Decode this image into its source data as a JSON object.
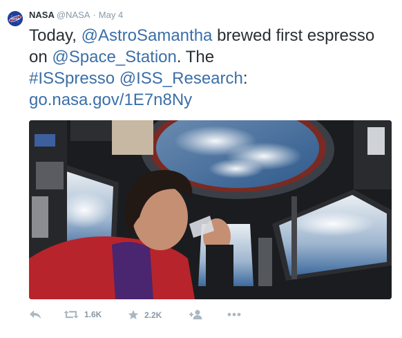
{
  "tweet": {
    "author_name": "NASA",
    "author_handle": "@NASA",
    "separator": "·",
    "timestamp": "May 4",
    "text": {
      "part1": "Today, ",
      "mention1": "@AstroSamantha",
      "part2": " brewed first espresso on ",
      "mention2": "@Space_Station",
      "part3": ". The ",
      "hashtag": "#ISSpresso",
      "part4": " ",
      "mention3": "@ISS_Research",
      "part5": ": ",
      "link": "go.nasa.gov/1E7n8Ny"
    },
    "media": {
      "icon": "photo-astronaut-cupola"
    },
    "actions": {
      "reply_icon": "reply-icon",
      "retweet_icon": "retweet-icon",
      "retweet_count": "1.6K",
      "favorite_icon": "star-icon",
      "favorite_count": "2.2K",
      "follow_icon": "follow-icon",
      "more_icon": "more-icon"
    }
  },
  "colors": {
    "link": "#3b6fa8",
    "text": "#292f33",
    "muted": "#8899a6",
    "icon": "#aab8c2"
  }
}
